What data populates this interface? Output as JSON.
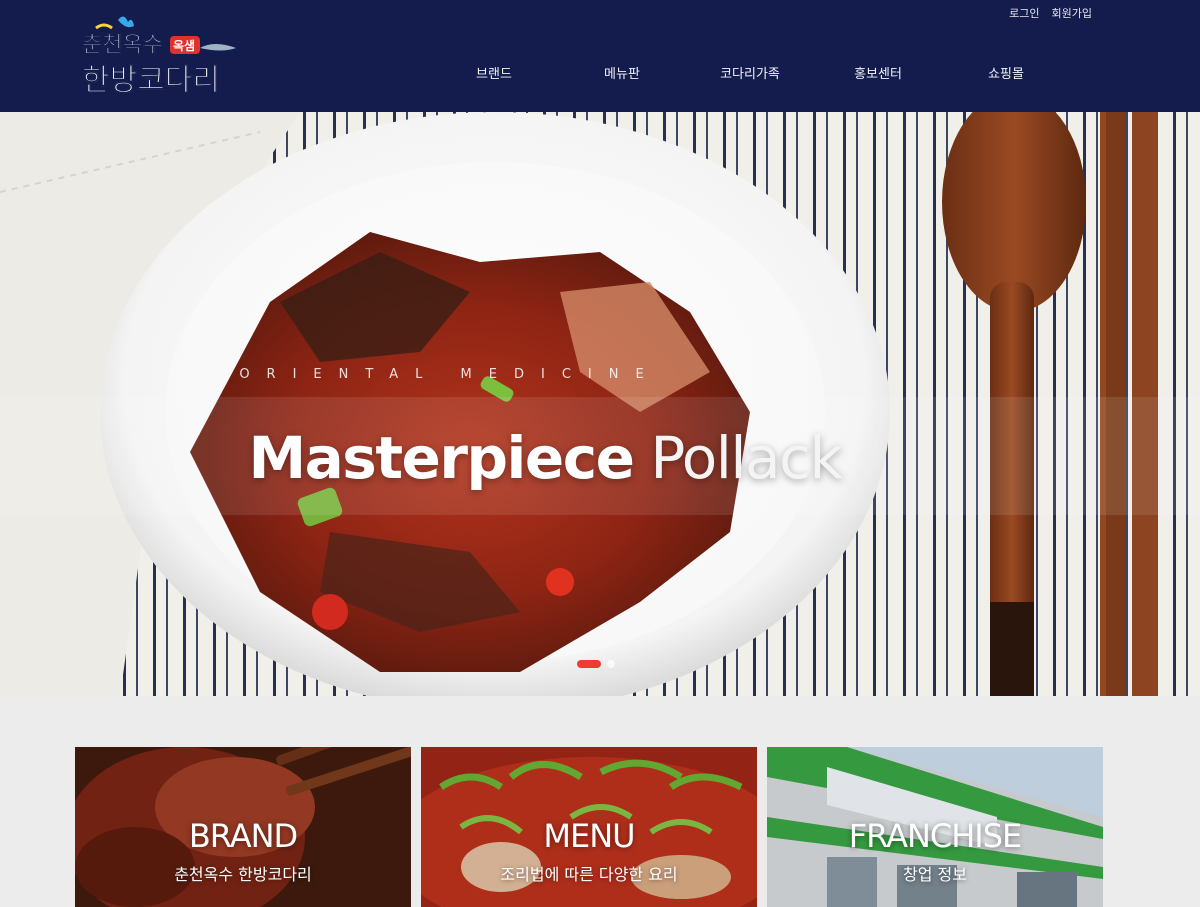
{
  "brand": {
    "logo_line1": "춘천옥수",
    "logo_badge": "옥샘",
    "logo_line2": "한방코다리"
  },
  "util_nav": [
    "로그인",
    "회원가입"
  ],
  "gnb": [
    "브랜드",
    "메뉴판",
    "코다리가족",
    "홍보센터",
    "쇼핑몰"
  ],
  "hero": {
    "kicker": "ORIENTAL MEDICINE",
    "title_bold": "Masterpiece",
    "title_light": "Pollack",
    "slides_total": 2,
    "slide_active": 1
  },
  "cards": [
    {
      "title": "BRAND",
      "subtitle": "춘천옥수 한방코다리"
    },
    {
      "title": "MENU",
      "subtitle": "조리법에 따른 다양한 요리"
    },
    {
      "title": "FRANCHISE",
      "subtitle": "창업 정보"
    }
  ],
  "colors": {
    "header_bg": "#131c4d",
    "accent": "#ef3c33",
    "page_bg": "#ececec"
  }
}
